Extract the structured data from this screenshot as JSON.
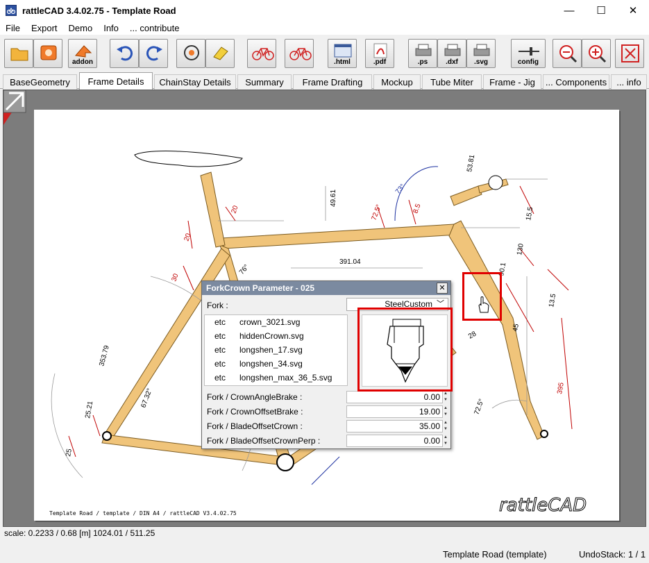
{
  "window": {
    "title": "rattleCAD  3.4.02.75 - Template Road",
    "minimize": "—",
    "maximize": "☐",
    "close": "✕"
  },
  "menu": [
    "File",
    "Export",
    "Demo",
    "Info",
    "... contribute"
  ],
  "toolbar": {
    "addon": "addon",
    "html": ".html",
    "pdf": ".pdf",
    "ps": ".ps",
    "dxf": ".dxf",
    "svg": ".svg",
    "config": "config"
  },
  "tabs": [
    "BaseGeometry",
    "Frame Details",
    "ChainStay Details",
    "Summary",
    "Frame Drafting",
    "Mockup",
    "Tube Miter",
    "Frame - Jig",
    "... Components",
    "... info"
  ],
  "active_tab": "Frame Details",
  "drawing": {
    "footer": "Template Road  /  template  /  DIN A4  /  rattleCAD  V3.4.02.75",
    "logo": "rattleCAD",
    "dims": [
      "391.04",
      "353.79",
      "67.32°",
      "25.21",
      "25",
      "20",
      "20",
      "30",
      "76°",
      "72.5°",
      "8.5",
      "73°",
      "49.61",
      "53.81",
      "15.5",
      "130",
      "90.1",
      "13.5",
      "45",
      "28",
      "395",
      "72.5°"
    ]
  },
  "dialog": {
    "title": "ForkCrown Parameter - 025",
    "close": "✕",
    "fork_label": "Fork  :",
    "fork_value": "SteelCustom",
    "files": [
      {
        "dir": "etc",
        "name": "crown_3021.svg"
      },
      {
        "dir": "etc",
        "name": "hiddenCrown.svg"
      },
      {
        "dir": "etc",
        "name": "longshen_17.svg"
      },
      {
        "dir": "etc",
        "name": "longshen_34.svg"
      },
      {
        "dir": "etc",
        "name": "longshen_max_36_5.svg"
      }
    ],
    "params": [
      {
        "label": "Fork / CrownAngleBrake  :",
        "value": "0.00"
      },
      {
        "label": "Fork / CrownOffsetBrake  :",
        "value": "19.00"
      },
      {
        "label": "Fork / BladeOffsetCrown  :",
        "value": "35.00"
      },
      {
        "label": "Fork / BladeOffsetCrownPerp  :",
        "value": "0.00"
      }
    ]
  },
  "status": {
    "scale": "scale: 0.2233 / 0.68  [m]  1024.01 / 511.25",
    "project": "Template Road (template)",
    "undo": "UndoStack:  1 / 1"
  },
  "colors": {
    "tube": "#f0c47a",
    "dim_red": "#c00000",
    "dim_blue": "#1a2fa0",
    "highlight": "#e00000"
  }
}
